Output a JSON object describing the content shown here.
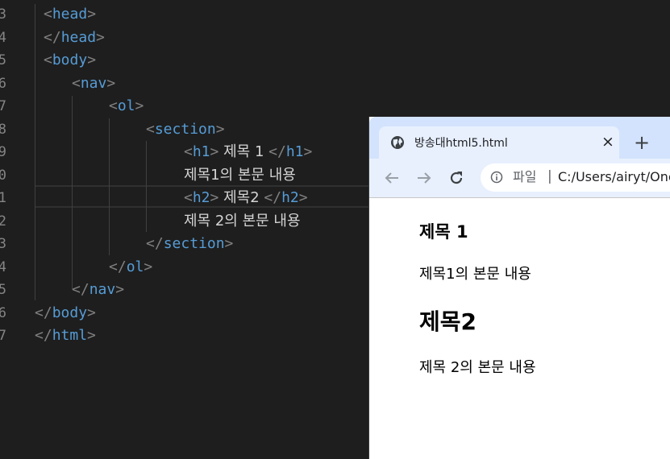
{
  "editor": {
    "line_numbers": [
      "3",
      "4",
      "5",
      "6",
      "7",
      "8",
      "9",
      "0",
      "1",
      "2",
      "3",
      "4",
      "5",
      "6",
      "7"
    ],
    "lines": [
      {
        "parts": [
          {
            "k": "b",
            "t": "<"
          },
          {
            "k": "tag",
            "t": "head"
          },
          {
            "k": "b",
            "t": ">"
          }
        ]
      },
      {
        "parts": [
          {
            "k": "b",
            "t": "</"
          },
          {
            "k": "tag",
            "t": "head"
          },
          {
            "k": "b",
            "t": ">"
          }
        ]
      },
      {
        "parts": [
          {
            "k": "b",
            "t": "<"
          },
          {
            "k": "tag",
            "t": "body"
          },
          {
            "k": "b",
            "t": ">"
          }
        ]
      },
      {
        "parts": [
          {
            "k": "b",
            "t": "<"
          },
          {
            "k": "tag",
            "t": "nav"
          },
          {
            "k": "b",
            "t": ">"
          }
        ]
      },
      {
        "parts": [
          {
            "k": "b",
            "t": "<"
          },
          {
            "k": "tag",
            "t": "ol"
          },
          {
            "k": "b",
            "t": ">"
          }
        ]
      },
      {
        "parts": [
          {
            "k": "b",
            "t": "<"
          },
          {
            "k": "tag",
            "t": "section"
          },
          {
            "k": "b",
            "t": ">"
          }
        ]
      },
      {
        "parts": [
          {
            "k": "b",
            "t": "<"
          },
          {
            "k": "tag",
            "t": "h1"
          },
          {
            "k": "b",
            "t": ">"
          },
          {
            "k": "txt",
            "t": " 제목 1 "
          },
          {
            "k": "b",
            "t": "</"
          },
          {
            "k": "tag",
            "t": "h1"
          },
          {
            "k": "b",
            "t": ">"
          }
        ]
      },
      {
        "parts": [
          {
            "k": "txt",
            "t": "제목1의 본문 내용"
          }
        ]
      },
      {
        "parts": [
          {
            "k": "b",
            "t": "<"
          },
          {
            "k": "tag",
            "t": "h2"
          },
          {
            "k": "b",
            "t": ">"
          },
          {
            "k": "txt",
            "t": " 제목2 "
          },
          {
            "k": "b",
            "t": "</"
          },
          {
            "k": "tag",
            "t": "h2"
          },
          {
            "k": "b",
            "t": ">"
          }
        ]
      },
      {
        "parts": [
          {
            "k": "txt",
            "t": "제목 2의 본문 내용"
          }
        ]
      },
      {
        "parts": [
          {
            "k": "b",
            "t": "</"
          },
          {
            "k": "tag",
            "t": "section"
          },
          {
            "k": "b",
            "t": ">"
          }
        ]
      },
      {
        "parts": [
          {
            "k": "b",
            "t": "</"
          },
          {
            "k": "tag",
            "t": "ol"
          },
          {
            "k": "b",
            "t": ">"
          }
        ]
      },
      {
        "parts": [
          {
            "k": "b",
            "t": "</"
          },
          {
            "k": "tag",
            "t": "nav"
          },
          {
            "k": "b",
            "t": ">"
          }
        ]
      },
      {
        "parts": [
          {
            "k": "b",
            "t": "</"
          },
          {
            "k": "tag",
            "t": "body"
          },
          {
            "k": "b",
            "t": ">"
          }
        ]
      },
      {
        "parts": [
          {
            "k": "b",
            "t": "</"
          },
          {
            "k": "tag",
            "t": "html"
          },
          {
            "k": "b",
            "t": ">"
          }
        ]
      }
    ]
  },
  "browser": {
    "tab_title": "방송대html5.html",
    "tab_close": "×",
    "new_tab": "+",
    "omnibox": {
      "label": "파일",
      "separator": "|",
      "url": "C:/Users/airyt/One"
    }
  },
  "page": {
    "h1": "제목 1",
    "p1": "제목1의 본문 내용",
    "h2": "제목2",
    "p2": "제목 2의 본문 내용"
  },
  "colors": {
    "editor_bg": "#1e1e1e",
    "tag": "#569cd6",
    "bracket": "#808080",
    "text": "#d4d4d4",
    "tabstrip": "#d3e3fd"
  }
}
